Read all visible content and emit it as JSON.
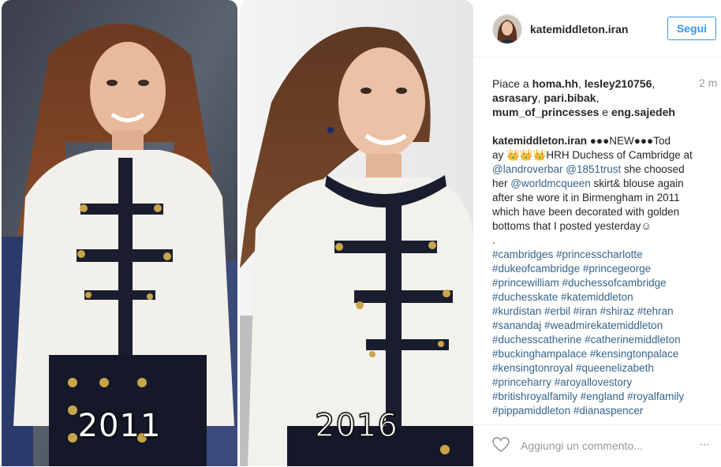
{
  "photo": {
    "left_year": "2011",
    "right_year": "2016"
  },
  "header": {
    "username": "katemiddleton.iran",
    "follow_label": "Segui"
  },
  "likes": {
    "prefix": "Piace a ",
    "users": [
      "homa.hh",
      "lesley210756",
      "asrasary",
      "pari.bibak",
      "mum_of_princesses",
      "eng.sajedeh"
    ],
    "conjunction": " e "
  },
  "timestamp": "2 m",
  "caption": {
    "username": "katemiddleton.iran",
    "lines": [
      " ●●●NEW●●●Tod",
      "ay 👑👑👑HRH Duchess of Cambridge at",
      "@landroverbar @1851trust she choosed",
      "her @worldmcqueen skirt& blouse again",
      "after she wore it in Birmengham in 2011",
      "which have been decorated with golden",
      "bottoms that I posted yesterday☺",
      "."
    ],
    "hashtag_lines": [
      "#cambridges #princesscharlotte",
      "#dukeofcambridge #princegeorge",
      "#princewilliam #duchessofcambridge",
      "#duchesskate #katemiddleton",
      "#kurdistan #erbil #iran #shiraz #tehran",
      "#sanandaj #weadmirekatemiddleton",
      "#duchesscatherine #catherinemiddleton",
      "#buckinghampalace #kensingtonpalace",
      "#kensingtonroyal #queenelizabeth",
      "#princeharry #aroyallovestory",
      "#britishroyalfamily #england #royalfamily",
      "#pippamiddleton #dianaspencer"
    ]
  },
  "footer": {
    "comment_placeholder": "Aggiungi un commento...",
    "more_label": "···"
  },
  "colors": {
    "accent": "#3897f0",
    "link": "#36648b",
    "muted": "#999999"
  },
  "icons": [
    "heart-icon",
    "more-options-icon"
  ]
}
